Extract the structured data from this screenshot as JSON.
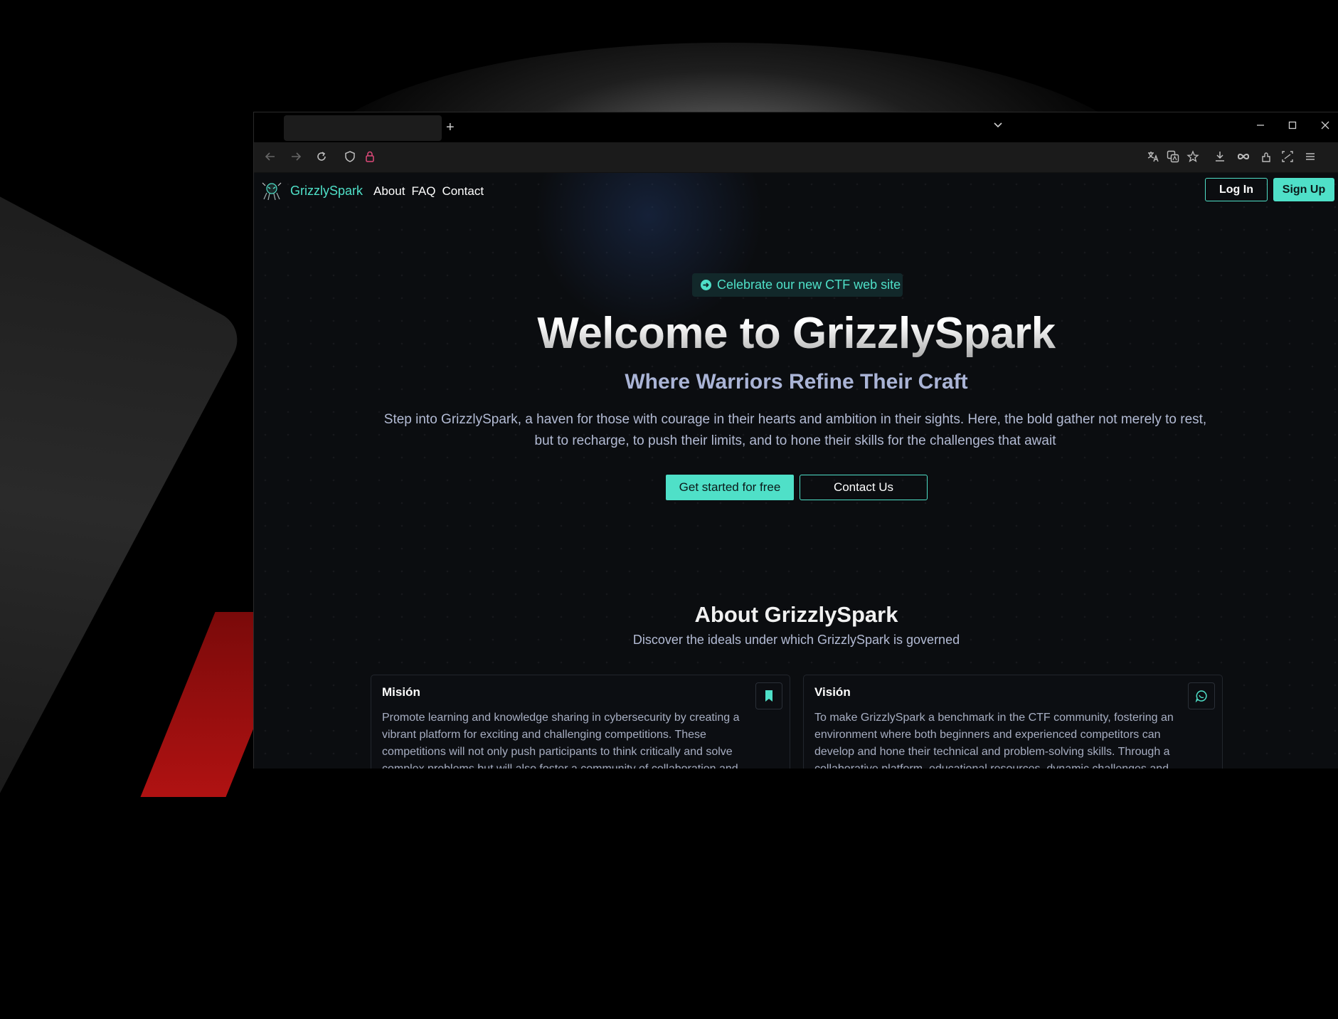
{
  "browser": {
    "new_tab_icon": "plus-icon",
    "tab_list_icon": "chevron-down-icon",
    "controls": [
      "minimize-icon",
      "maximize-icon",
      "close-icon"
    ],
    "toolbar_icons": [
      "back-arrow-icon",
      "forward-arrow-icon",
      "reload-icon",
      "shield-icon",
      "lock-icon"
    ],
    "right_icons": [
      "translate-icon",
      "translate-page-icon",
      "star-icon",
      "download-icon",
      "infinity-icon",
      "extensions-icon",
      "screenshot-icon",
      "menu-icon"
    ]
  },
  "site": {
    "brand": "GrizzlySpark",
    "nav": [
      "About",
      "FAQ",
      "Contact"
    ],
    "login_label": "Log In",
    "signup_label": "Sign Up"
  },
  "hero": {
    "announcement": "Celebrate our new CTF web site",
    "title": "Welcome to GrizzlySpark",
    "subtitle": "Where Warriors Refine Their Craft",
    "description": "Step into GrizzlySpark, a haven for those with courage in their hearts and ambition in their sights. Here, the bold gather not merely to rest, but to recharge, to push their limits, and to hone their skills for the challenges that await",
    "primary_button": "Get started for free",
    "secondary_button": "Contact Us"
  },
  "about": {
    "title": "About GrizzlySpark",
    "subtitle": "Discover the ideals under which GrizzlySpark is governed",
    "cards": [
      {
        "title": "Misión",
        "icon": "bookmark-icon",
        "text": "Promote learning and knowledge sharing in cybersecurity by creating a vibrant platform for exciting and challenging competitions. These competitions will not only push participants to think critically and solve complex problems but will also foster a community of collaboration and"
      },
      {
        "title": "Visión",
        "icon": "chat-icon",
        "text": "To make GrizzlySpark a benchmark in the CTF community, fostering an environment where both beginners and experienced competitors can develop and hone their technical and problem-solving skills. Through a collaborative platform, educational resources, dynamic challenges and"
      }
    ]
  },
  "colors": {
    "accent": "#4fe0c8",
    "background": "#0b0d10"
  }
}
